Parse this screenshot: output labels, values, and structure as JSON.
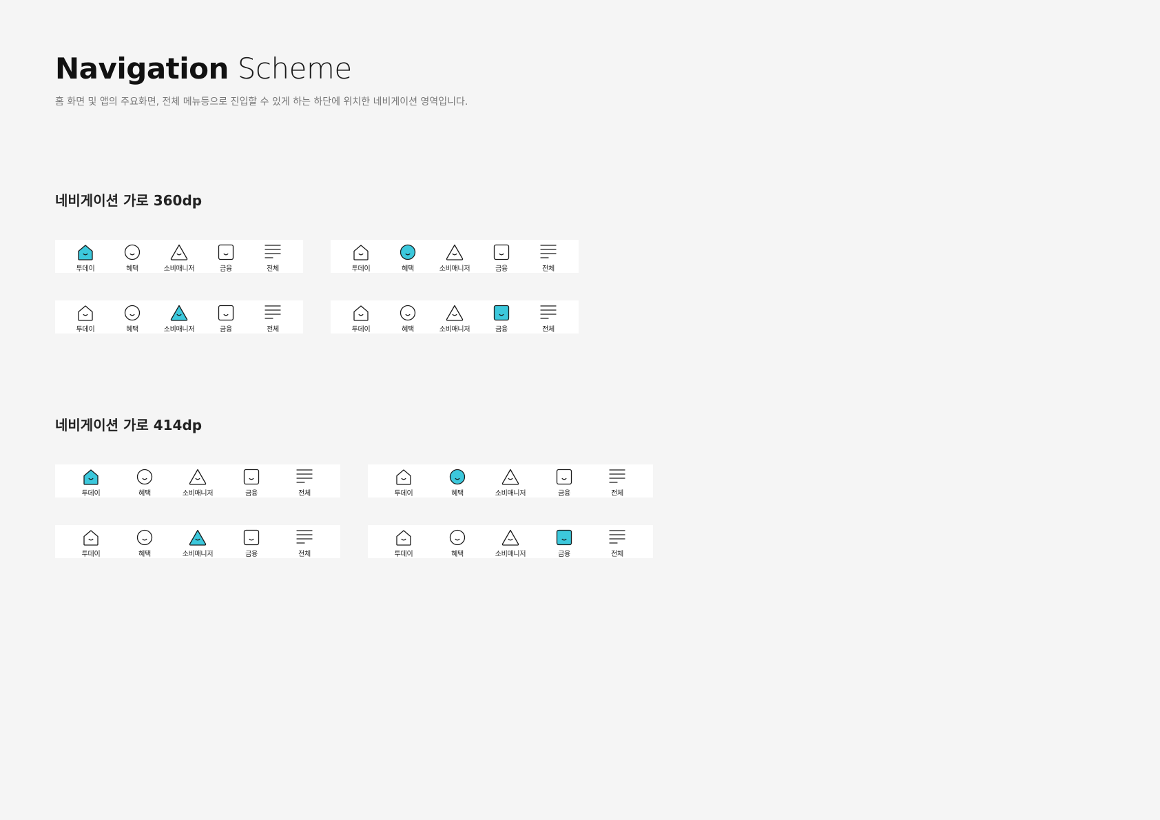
{
  "header": {
    "title_bold": "Navigation",
    "title_light": "Scheme",
    "subtitle": "홈 화면 및 앱의 주요화면, 전체 메뉴등으로 진입할 수 있게 하는 하단에 위치한 네비게이션 영역입니다."
  },
  "sections": [
    {
      "heading": "네비게이션 가로 360dp"
    },
    {
      "heading": "네비게이션 가로 414dp"
    }
  ],
  "nav_items": [
    {
      "label": "투데이",
      "icon": "home-icon"
    },
    {
      "label": "혜택",
      "icon": "smile-circle-icon"
    },
    {
      "label": "소비매니저",
      "icon": "triangle-smile-icon"
    },
    {
      "label": "금융",
      "icon": "square-smile-icon"
    },
    {
      "label": "전체",
      "icon": "menu-lines-icon"
    }
  ],
  "variants": [
    {
      "section": 0,
      "active_index": 0
    },
    {
      "section": 0,
      "active_index": 1
    },
    {
      "section": 0,
      "active_index": 2
    },
    {
      "section": 0,
      "active_index": 3
    },
    {
      "section": 1,
      "active_index": 0
    },
    {
      "section": 1,
      "active_index": 1
    },
    {
      "section": 1,
      "active_index": 2
    },
    {
      "section": 1,
      "active_index": 3
    }
  ],
  "colors": {
    "active_fill": "#3cc8dc",
    "stroke": "#1a1a1a",
    "bar_background": "#ffffff",
    "page_background": "#f5f5f5"
  }
}
